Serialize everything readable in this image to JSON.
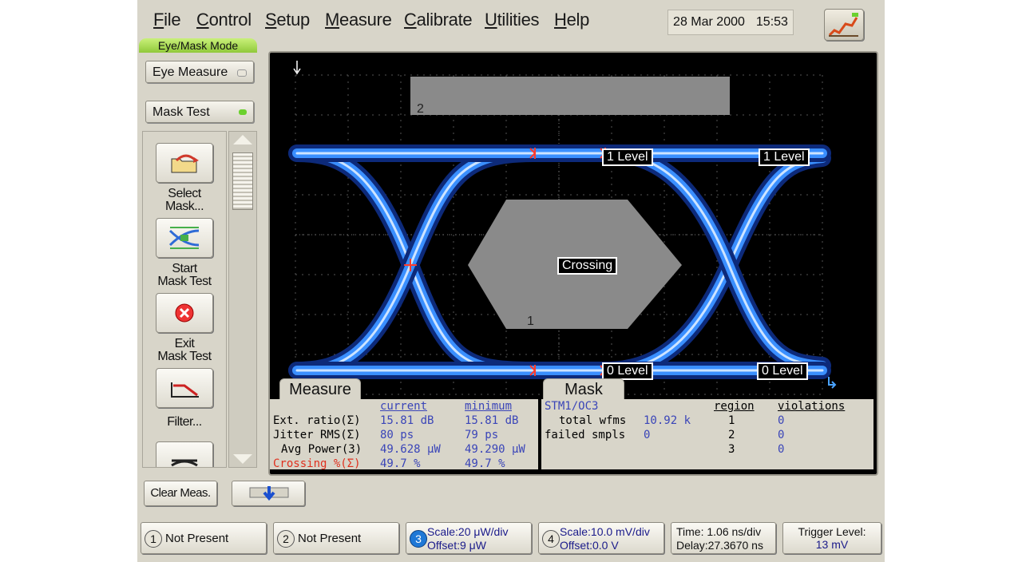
{
  "menu": [
    "File",
    "Control",
    "Setup",
    "Measure",
    "Calibrate",
    "Utilities",
    "Help"
  ],
  "datetime": {
    "date": "28 Mar 2000",
    "time": "15:53"
  },
  "mode_tab": "Eye/Mask Mode",
  "side": {
    "eye_measure": "Eye Measure",
    "mask_test": "Mask Test"
  },
  "tools": {
    "select_mask": [
      "Select",
      "Mask..."
    ],
    "start_mask": [
      "Start",
      "Mask Test"
    ],
    "exit_mask": [
      "Exit",
      "Mask Test"
    ],
    "filter": [
      "Filter..."
    ]
  },
  "scope": {
    "mask_labels": [
      "2",
      "1"
    ],
    "markers": {
      "l1a": "1 Level",
      "l1b": "1 Level",
      "crossing": "Crossing",
      "l0a": "0 Level",
      "l0b": "0 Level"
    }
  },
  "measure": {
    "tab": "Measure",
    "headers": {
      "current": "current",
      "minimum": "minimum"
    },
    "rows": [
      {
        "label": "Ext. ratio(Σ)",
        "current": "15.81 dB",
        "minimum": "15.81 dB"
      },
      {
        "label": "Jitter RMS(Σ)",
        "current": "80 ps",
        "minimum": "79 ps"
      },
      {
        "label": "Avg Power(3)",
        "current": "49.628 μW",
        "minimum": "49.290 μW"
      },
      {
        "label": "Crossing %(Σ)",
        "current": "49.7 %",
        "minimum": "49.7 %"
      }
    ]
  },
  "mask": {
    "tab": "Mask",
    "name": "STM1/OC3",
    "total_label": "total wfms",
    "total_value": "10.92 k",
    "failed_label": "failed smpls",
    "failed_value": "0",
    "headers": {
      "region": "region",
      "violations": "violations"
    },
    "regions": [
      {
        "r": "1",
        "v": "0"
      },
      {
        "r": "2",
        "v": "0"
      },
      {
        "r": "3",
        "v": "0"
      }
    ]
  },
  "clear_meas": "Clear Meas.",
  "bottom": {
    "ch1": {
      "num": "1",
      "text": "Not Present"
    },
    "ch2": {
      "num": "2",
      "text": "Not Present"
    },
    "ch3": {
      "num": "3",
      "scale": "Scale:20 μW/div",
      "offset": "Offset:9 μW"
    },
    "ch4": {
      "num": "4",
      "scale": "Scale:10.0 mV/div",
      "offset": "Offset:0.0 V"
    },
    "time": {
      "time": "Time: 1.06 ns/div",
      "delay": "Delay:27.3670 ns"
    },
    "trigger": {
      "label": "Trigger Level:",
      "value": "13 mV"
    }
  },
  "colors": {
    "trace": "#3a8fff",
    "marker": "#ff3b2b",
    "mask": "#8a8a8a",
    "accent_green": "#6bd12e"
  }
}
